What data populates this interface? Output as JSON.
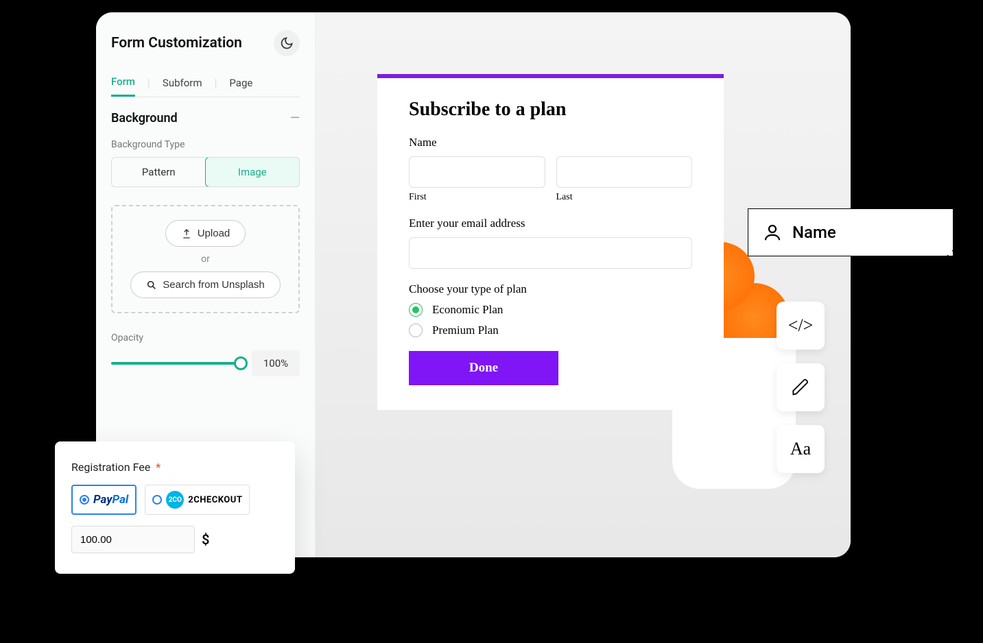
{
  "sidebar": {
    "title": "Form Customization",
    "tabs": [
      "Form",
      "Subform",
      "Page"
    ],
    "active_tab": 0,
    "section": "Background",
    "bg_type_label": "Background Type",
    "bg_types": [
      "Pattern",
      "Image"
    ],
    "bg_type_selected": 1,
    "upload_label": "Upload",
    "or_label": "or",
    "unsplash_label": "Search from Unsplash",
    "opacity_label": "Opacity",
    "opacity_value": "100%"
  },
  "preview": {
    "title": "Subscribe to a plan",
    "name_label": "Name",
    "first_label": "First",
    "last_label": "Last",
    "email_label": "Enter your email address",
    "plan_label": "Choose your type of plan",
    "plan_options": [
      "Economic Plan",
      "Premium Plan"
    ],
    "plan_selected": 0,
    "done_label": "Done"
  },
  "floating_field": {
    "label": "Name"
  },
  "tools": {
    "code": "</>",
    "text": "Aa"
  },
  "payment": {
    "title": "Registration Fee",
    "paypal": "PayPal",
    "checkout_badge": "2CO",
    "checkout_label": "2CHECKOUT",
    "selected": 0,
    "amount": "100.00",
    "currency": "$"
  }
}
